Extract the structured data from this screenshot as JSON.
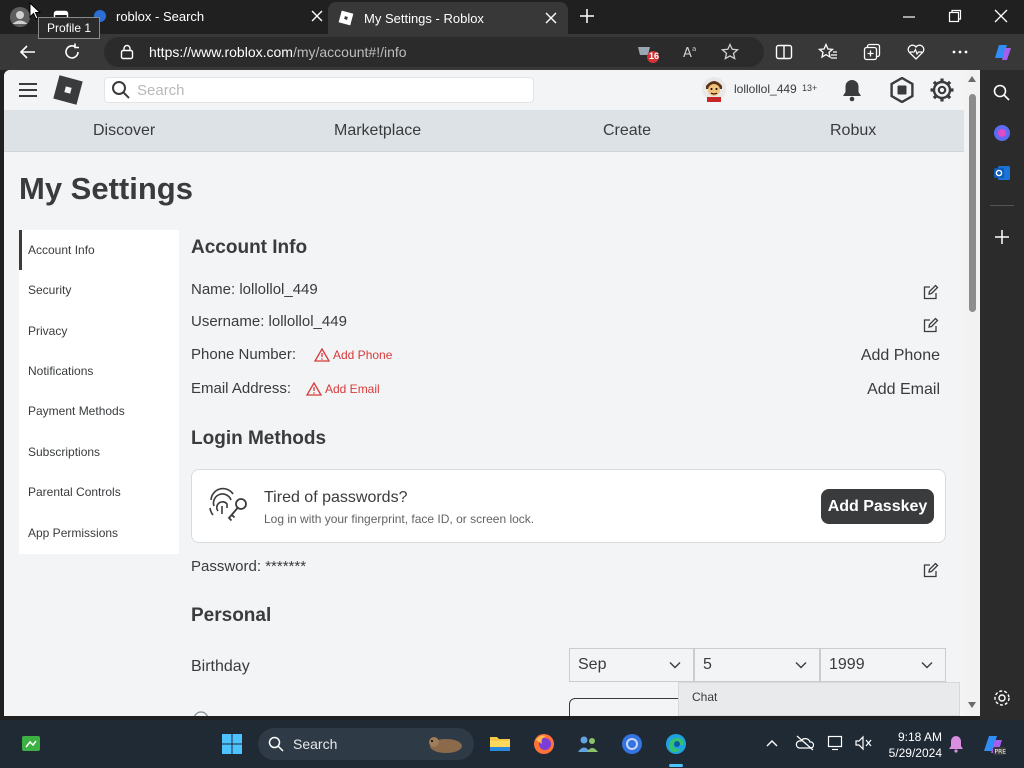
{
  "browser": {
    "profile_tooltip": "Profile 1",
    "tabs": [
      {
        "title": "roblox - Search"
      },
      {
        "title": "My Settings - Roblox"
      }
    ],
    "url_host": "https://www.roblox.com",
    "url_path": "/my/account#!/info",
    "collections_badge": "16"
  },
  "roblox": {
    "search_placeholder": "Search",
    "username": "lollollol_449",
    "age_badge": "13+",
    "nav": [
      "Discover",
      "Marketplace",
      "Create",
      "Robux"
    ]
  },
  "settings": {
    "title": "My Settings",
    "menu": [
      "Account Info",
      "Security",
      "Privacy",
      "Notifications",
      "Payment Methods",
      "Subscriptions",
      "Parental Controls",
      "App Permissions"
    ],
    "account_info": {
      "heading": "Account Info",
      "name": "Name: lollollol_449",
      "username": "Username: lollollol_449",
      "phone_label": "Phone Number:",
      "phone_warning": "Add Phone",
      "phone_action": "Add Phone",
      "email_label": "Email Address:",
      "email_warning": "Add Email",
      "email_action": "Add Email"
    },
    "login_methods": {
      "heading": "Login Methods",
      "card_title": "Tired of passwords?",
      "card_subtitle": "Log in with your fingerprint, face ID, or screen lock.",
      "passkey_button": "Add Passkey",
      "password": "Password: *******"
    },
    "personal": {
      "heading": "Personal",
      "birthday_label": "Birthday",
      "birth_month": "Sep",
      "birth_day": "5",
      "birth_year": "1999"
    },
    "chat_label": "Chat"
  },
  "taskbar": {
    "search_label": "Search",
    "time": "9:18 AM",
    "date": "5/29/2024"
  },
  "colors": {
    "page_bg": "#f2f4f5",
    "nav_bg": "#dde2e6",
    "warning": "#d93a3a",
    "button_dark": "#393b3d"
  }
}
